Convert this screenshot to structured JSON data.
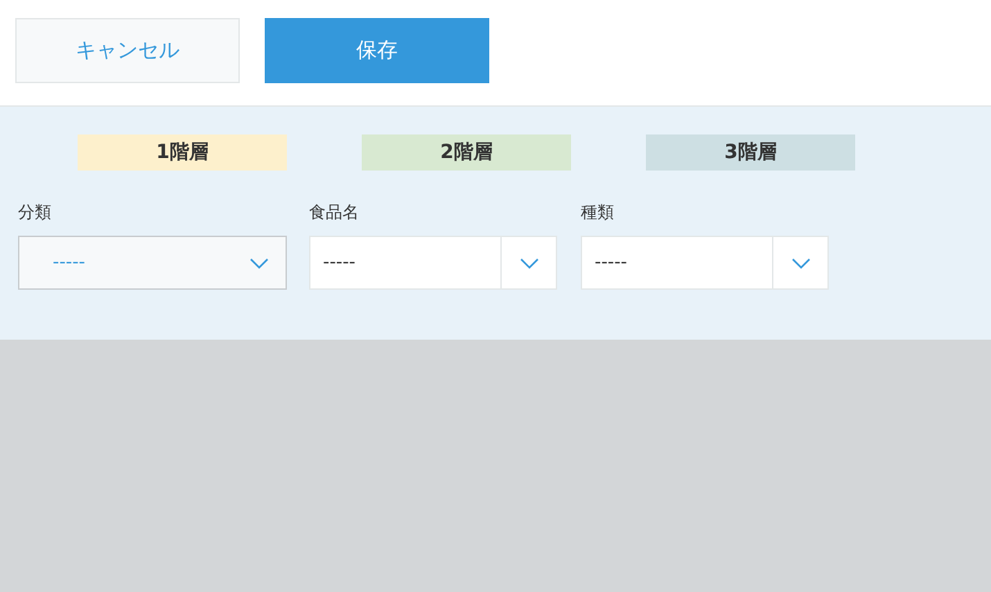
{
  "buttons": [
    {
      "label": "キャンセル",
      "kind": "cancel"
    },
    {
      "label": "保存",
      "kind": "save"
    }
  ],
  "levels": [
    {
      "label": "1階層",
      "color": "#fdf0cc"
    },
    {
      "label": "2階層",
      "color": "#d8e9d1"
    },
    {
      "label": "3階層",
      "color": "#cddfe3"
    }
  ],
  "fields": [
    {
      "label": "分類",
      "value": "-----",
      "hovered": true
    },
    {
      "label": "食品名",
      "value": "-----",
      "hovered": false
    },
    {
      "label": "種類",
      "value": "-----",
      "hovered": false
    }
  ]
}
